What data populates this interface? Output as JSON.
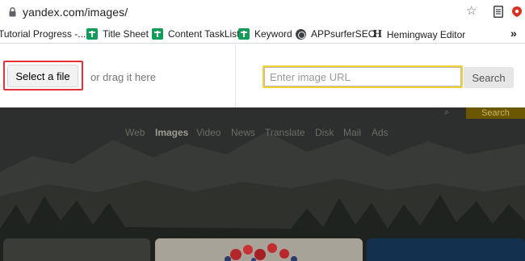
{
  "browser": {
    "url": "yandex.com/images/",
    "bookmarks": [
      {
        "label": "Tutorial Progress -...",
        "icon": "none"
      },
      {
        "label": "Title Sheet",
        "icon": "google-sheets-icon"
      },
      {
        "label": "Content TaskList",
        "icon": "google-sheets-icon"
      },
      {
        "label": "Keyword",
        "icon": "google-sheets-icon"
      },
      {
        "label": "APPsurferSEO",
        "icon": "globe-icon"
      },
      {
        "label": "Hemingway Editor",
        "icon": "hemingway-h-icon"
      }
    ],
    "more_label": "»"
  },
  "upload_panel": {
    "select_file_label": "Select a file",
    "drag_text": "or drag it here",
    "url_placeholder": "Enter image URL",
    "search_label": "Search"
  },
  "background_page": {
    "search_label": "Search",
    "nav": [
      {
        "label": "Web",
        "active": false
      },
      {
        "label": "Images",
        "active": true
      },
      {
        "label": "Video",
        "active": false
      },
      {
        "label": "News",
        "active": false
      },
      {
        "label": "Translate",
        "active": false
      },
      {
        "label": "Disk",
        "active": false
      },
      {
        "label": "Mail",
        "active": false
      },
      {
        "label": "Ads",
        "active": false
      }
    ]
  },
  "colors": {
    "highlight_red": "#e2333a",
    "highlight_yellow": "#f5d033",
    "sheets_green": "#0f9d58"
  }
}
